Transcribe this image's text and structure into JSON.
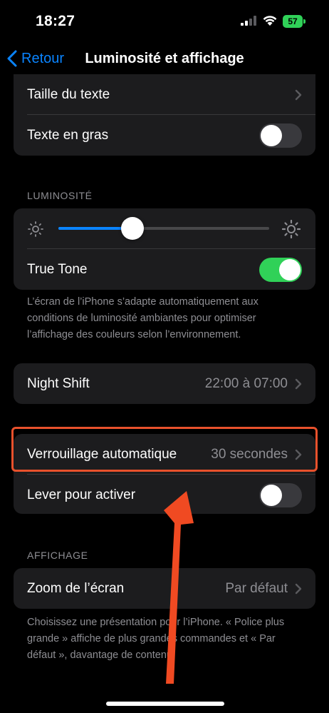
{
  "status_bar": {
    "time": "18:27",
    "battery": "57"
  },
  "nav": {
    "back_label": "Retour",
    "title": "Luminosité et affichage"
  },
  "text_group": {
    "text_size": "Taille du texte",
    "bold_text": "Texte en gras",
    "bold_on": false
  },
  "brightness": {
    "header": "LUMINOSITÉ",
    "level": 0.35,
    "true_tone": "True Tone",
    "true_tone_on": true,
    "footer": "L’écran de l’iPhone s’adapte automatiquement aux conditions de luminosité ambiantes pour optimiser l’affichage des couleurs selon l’environnement."
  },
  "night_shift": {
    "label": "Night Shift",
    "value": "22:00 à 07:00"
  },
  "lock_group": {
    "auto_lock": "Verrouillage automatique",
    "auto_lock_value": "30 secondes",
    "raise_to_wake": "Lever pour activer",
    "raise_on": false
  },
  "display": {
    "header": "AFFICHAGE",
    "zoom": "Zoom de l’écran",
    "zoom_value": "Par défaut",
    "footer": "Choisissez une présentation pour l’iPhone. « Police plus grande » affiche de plus grandes commandes et « Par défaut », davantage de contenu."
  },
  "colors": {
    "accent": "#0a84ff",
    "toggle_on": "#30d158",
    "annotation": "#e8512c"
  }
}
